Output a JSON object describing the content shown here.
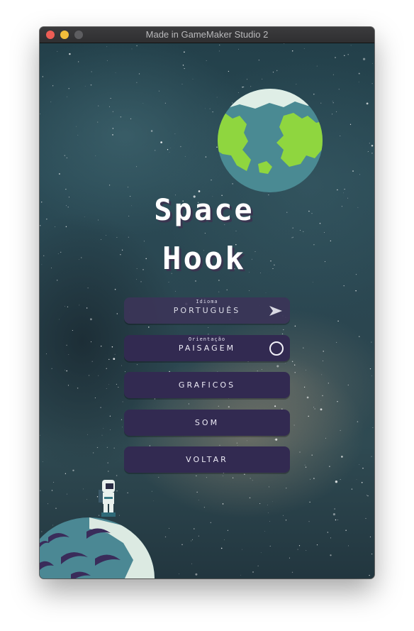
{
  "window": {
    "title": "Made in GameMaker Studio 2"
  },
  "game": {
    "title_line1": "Space",
    "title_line2": "Hook",
    "menu": [
      {
        "small_label": "Idioma",
        "label": "PORTUGUÊS",
        "icon": "arrow-right-icon"
      },
      {
        "small_label": "Orientação",
        "label": "PAISAGEM",
        "icon": "circle-icon"
      },
      {
        "label": "GRAFICOS"
      },
      {
        "label": "SOM"
      },
      {
        "label": "VOLTAR"
      }
    ]
  },
  "colors": {
    "button_bg": "#322a51",
    "planet_ocean": "#4a8a93",
    "planet_land": "#8fd63f",
    "planet_ice": "#dfeee6",
    "moon_surface": "#4b8894",
    "crater": "#3a2c5a"
  }
}
